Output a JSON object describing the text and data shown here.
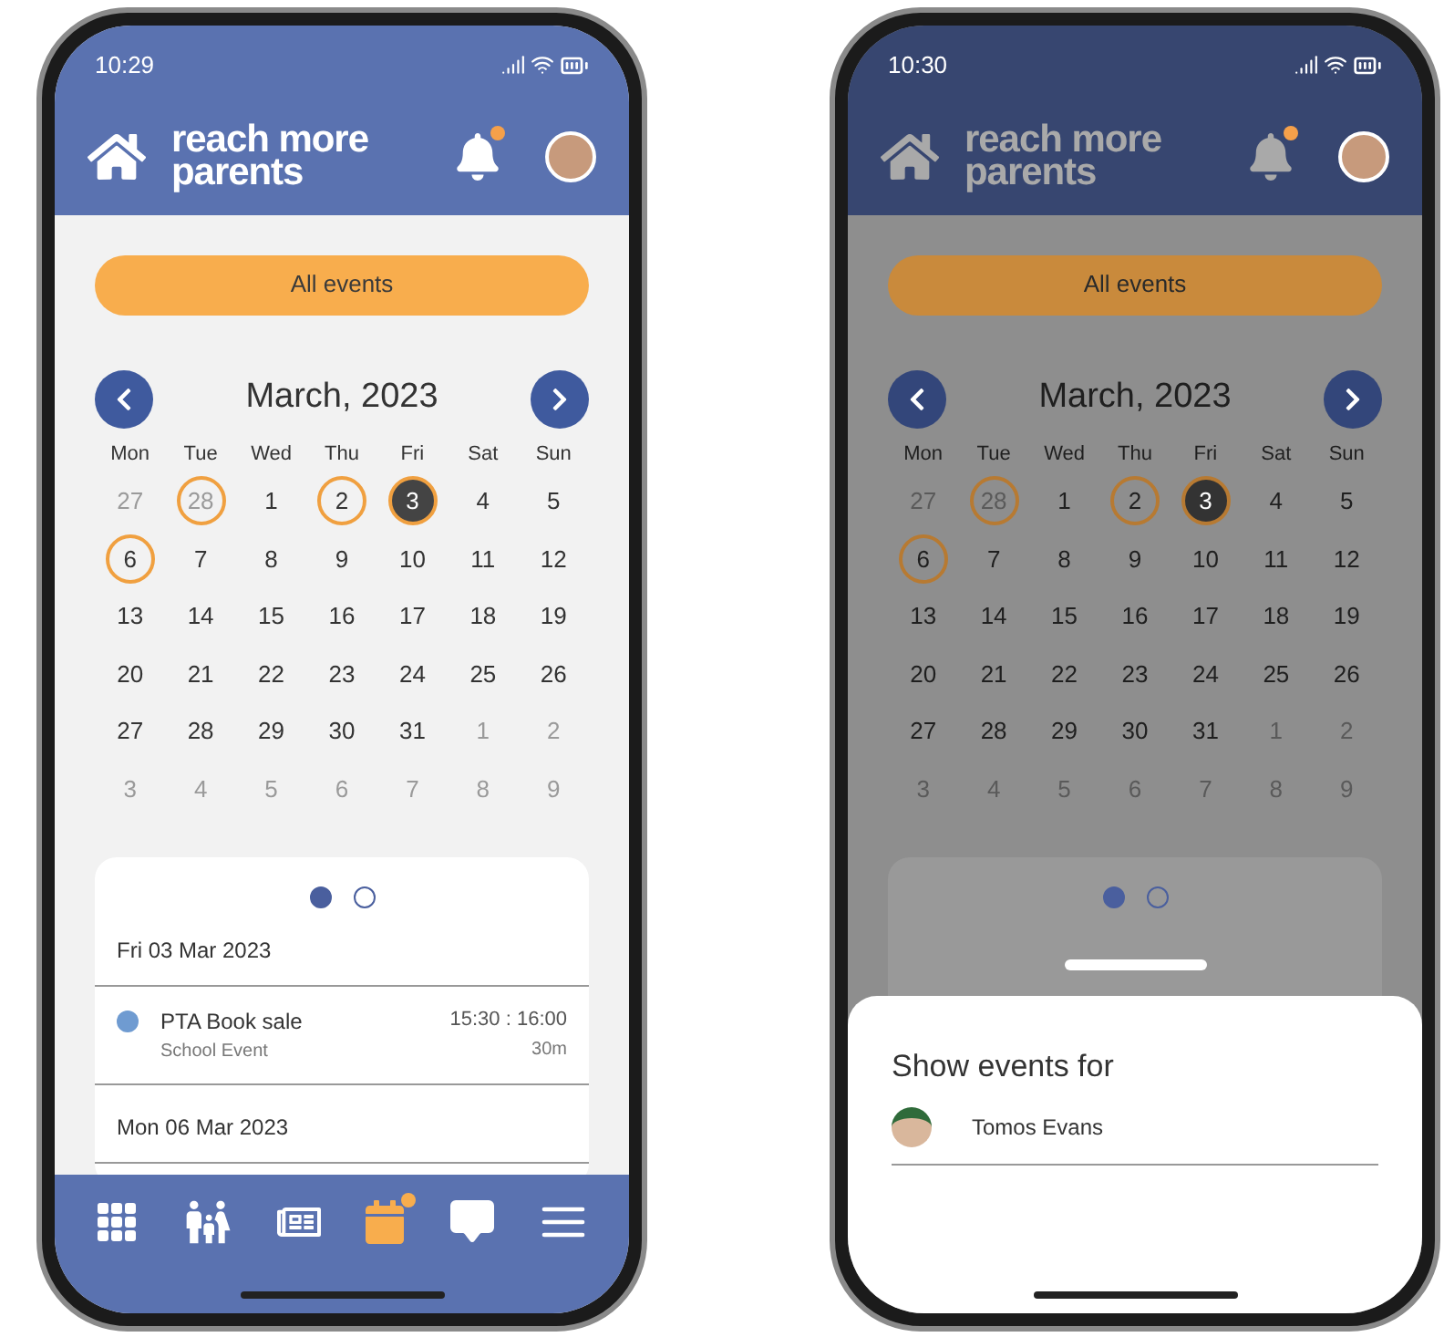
{
  "phones": [
    {
      "dimmed": false,
      "status_bar": {
        "time": "10:29"
      },
      "header": {
        "logo_lines": [
          "reach more",
          "parents"
        ],
        "notification_badge": true
      },
      "filter_button": "All events",
      "calendar": {
        "month": "March, 2023",
        "weekdays": [
          "Mon",
          "Tue",
          "Wed",
          "Thu",
          "Fri",
          "Sat",
          "Sun"
        ],
        "days": [
          {
            "label": "27",
            "muted": true,
            "event": false,
            "selected": false
          },
          {
            "label": "28",
            "muted": true,
            "event": true,
            "selected": false
          },
          {
            "label": "1",
            "muted": false,
            "event": false,
            "selected": false
          },
          {
            "label": "2",
            "muted": false,
            "event": true,
            "selected": false
          },
          {
            "label": "3",
            "muted": false,
            "event": true,
            "selected": true
          },
          {
            "label": "4",
            "muted": false,
            "event": false,
            "selected": false
          },
          {
            "label": "5",
            "muted": false,
            "event": false,
            "selected": false
          },
          {
            "label": "6",
            "muted": false,
            "event": true,
            "selected": false
          },
          {
            "label": "7",
            "muted": false,
            "event": false,
            "selected": false
          },
          {
            "label": "8",
            "muted": false,
            "event": false,
            "selected": false
          },
          {
            "label": "9",
            "muted": false,
            "event": false,
            "selected": false
          },
          {
            "label": "10",
            "muted": false,
            "event": false,
            "selected": false
          },
          {
            "label": "11",
            "muted": false,
            "event": false,
            "selected": false
          },
          {
            "label": "12",
            "muted": false,
            "event": false,
            "selected": false
          },
          {
            "label": "13",
            "muted": false,
            "event": false,
            "selected": false
          },
          {
            "label": "14",
            "muted": false,
            "event": false,
            "selected": false
          },
          {
            "label": "15",
            "muted": false,
            "event": false,
            "selected": false
          },
          {
            "label": "16",
            "muted": false,
            "event": false,
            "selected": false
          },
          {
            "label": "17",
            "muted": false,
            "event": false,
            "selected": false
          },
          {
            "label": "18",
            "muted": false,
            "event": false,
            "selected": false
          },
          {
            "label": "19",
            "muted": false,
            "event": false,
            "selected": false
          },
          {
            "label": "20",
            "muted": false,
            "event": false,
            "selected": false
          },
          {
            "label": "21",
            "muted": false,
            "event": false,
            "selected": false
          },
          {
            "label": "22",
            "muted": false,
            "event": false,
            "selected": false
          },
          {
            "label": "23",
            "muted": false,
            "event": false,
            "selected": false
          },
          {
            "label": "24",
            "muted": false,
            "event": false,
            "selected": false
          },
          {
            "label": "25",
            "muted": false,
            "event": false,
            "selected": false
          },
          {
            "label": "26",
            "muted": false,
            "event": false,
            "selected": false
          },
          {
            "label": "27",
            "muted": false,
            "event": false,
            "selected": false
          },
          {
            "label": "28",
            "muted": false,
            "event": false,
            "selected": false
          },
          {
            "label": "29",
            "muted": false,
            "event": false,
            "selected": false
          },
          {
            "label": "30",
            "muted": false,
            "event": false,
            "selected": false
          },
          {
            "label": "31",
            "muted": false,
            "event": false,
            "selected": false
          },
          {
            "label": "1",
            "muted": true,
            "event": false,
            "selected": false
          },
          {
            "label": "2",
            "muted": true,
            "event": false,
            "selected": false
          },
          {
            "label": "3",
            "muted": true,
            "event": false,
            "selected": false
          },
          {
            "label": "4",
            "muted": true,
            "event": false,
            "selected": false
          },
          {
            "label": "5",
            "muted": true,
            "event": false,
            "selected": false
          },
          {
            "label": "6",
            "muted": true,
            "event": false,
            "selected": false
          },
          {
            "label": "7",
            "muted": true,
            "event": false,
            "selected": false
          },
          {
            "label": "8",
            "muted": true,
            "event": false,
            "selected": false
          },
          {
            "label": "9",
            "muted": true,
            "event": false,
            "selected": false
          }
        ]
      },
      "events_card": {
        "pages": [
          {
            "selected": true
          },
          {
            "selected": false
          }
        ],
        "groups": [
          {
            "date": "Fri 03 Mar 2023",
            "events": [
              {
                "title": "PTA Book sale",
                "subtitle": "School Event",
                "time": "15:30 : 16:00",
                "duration": "30m",
                "color": "#6f9bd1"
              }
            ]
          },
          {
            "date": "Mon 06 Mar 2023"
          }
        ]
      },
      "nav": [
        {
          "kind": "apps",
          "selected": false,
          "badge": false
        },
        {
          "kind": "family",
          "selected": false,
          "badge": false
        },
        {
          "kind": "news",
          "selected": false,
          "badge": false
        },
        {
          "kind": "calendar",
          "selected": true,
          "badge": true
        },
        {
          "kind": "chat",
          "selected": false,
          "badge": false
        },
        {
          "kind": "menu",
          "selected": false,
          "badge": false
        }
      ]
    },
    {
      "dimmed": true,
      "status_bar": {
        "time": "10:30"
      },
      "header": {
        "logo_lines": [
          "reach more",
          "parents"
        ],
        "notification_badge": true
      },
      "filter_button": "All events",
      "calendar": {
        "month": "March, 2023",
        "weekdays": [
          "Mon",
          "Tue",
          "Wed",
          "Thu",
          "Fri",
          "Sat",
          "Sun"
        ],
        "days": [
          {
            "label": "27",
            "muted": true,
            "event": false,
            "selected": false
          },
          {
            "label": "28",
            "muted": true,
            "event": true,
            "selected": false
          },
          {
            "label": "1",
            "muted": false,
            "event": false,
            "selected": false
          },
          {
            "label": "2",
            "muted": false,
            "event": true,
            "selected": false
          },
          {
            "label": "3",
            "muted": false,
            "event": true,
            "selected": true
          },
          {
            "label": "4",
            "muted": false,
            "event": false,
            "selected": false
          },
          {
            "label": "5",
            "muted": false,
            "event": false,
            "selected": false
          },
          {
            "label": "6",
            "muted": false,
            "event": true,
            "selected": false
          },
          {
            "label": "7",
            "muted": false,
            "event": false,
            "selected": false
          },
          {
            "label": "8",
            "muted": false,
            "event": false,
            "selected": false
          },
          {
            "label": "9",
            "muted": false,
            "event": false,
            "selected": false
          },
          {
            "label": "10",
            "muted": false,
            "event": false,
            "selected": false
          },
          {
            "label": "11",
            "muted": false,
            "event": false,
            "selected": false
          },
          {
            "label": "12",
            "muted": false,
            "event": false,
            "selected": false
          },
          {
            "label": "13",
            "muted": false,
            "event": false,
            "selected": false
          },
          {
            "label": "14",
            "muted": false,
            "event": false,
            "selected": false
          },
          {
            "label": "15",
            "muted": false,
            "event": false,
            "selected": false
          },
          {
            "label": "16",
            "muted": false,
            "event": false,
            "selected": false
          },
          {
            "label": "17",
            "muted": false,
            "event": false,
            "selected": false
          },
          {
            "label": "18",
            "muted": false,
            "event": false,
            "selected": false
          },
          {
            "label": "19",
            "muted": false,
            "event": false,
            "selected": false
          },
          {
            "label": "20",
            "muted": false,
            "event": false,
            "selected": false
          },
          {
            "label": "21",
            "muted": false,
            "event": false,
            "selected": false
          },
          {
            "label": "22",
            "muted": false,
            "event": false,
            "selected": false
          },
          {
            "label": "23",
            "muted": false,
            "event": false,
            "selected": false
          },
          {
            "label": "24",
            "muted": false,
            "event": false,
            "selected": false
          },
          {
            "label": "25",
            "muted": false,
            "event": false,
            "selected": false
          },
          {
            "label": "26",
            "muted": false,
            "event": false,
            "selected": false
          },
          {
            "label": "27",
            "muted": false,
            "event": false,
            "selected": false
          },
          {
            "label": "28",
            "muted": false,
            "event": false,
            "selected": false
          },
          {
            "label": "29",
            "muted": false,
            "event": false,
            "selected": false
          },
          {
            "label": "30",
            "muted": false,
            "event": false,
            "selected": false
          },
          {
            "label": "31",
            "muted": false,
            "event": false,
            "selected": false
          },
          {
            "label": "1",
            "muted": true,
            "event": false,
            "selected": false
          },
          {
            "label": "2",
            "muted": true,
            "event": false,
            "selected": false
          },
          {
            "label": "3",
            "muted": true,
            "event": false,
            "selected": false
          },
          {
            "label": "4",
            "muted": true,
            "event": false,
            "selected": false
          },
          {
            "label": "5",
            "muted": true,
            "event": false,
            "selected": false
          },
          {
            "label": "6",
            "muted": true,
            "event": false,
            "selected": false
          },
          {
            "label": "7",
            "muted": true,
            "event": false,
            "selected": false
          },
          {
            "label": "8",
            "muted": true,
            "event": false,
            "selected": false
          },
          {
            "label": "9",
            "muted": true,
            "event": false,
            "selected": false
          }
        ]
      },
      "events_card": {
        "pages": [
          {
            "selected": true
          },
          {
            "selected": false
          }
        ]
      },
      "sheet": {
        "title": "Show events for",
        "children": [
          {
            "name": "Tomos Evans"
          }
        ]
      }
    }
  ]
}
